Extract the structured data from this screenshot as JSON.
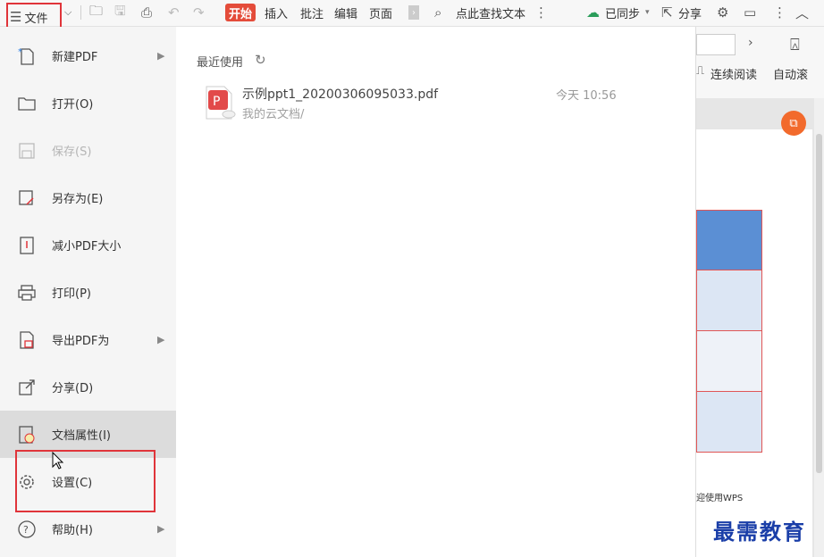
{
  "toolbar": {
    "file_label": "文件",
    "start_label": "开始",
    "tabs": [
      "插入",
      "批注",
      "编辑",
      "页面"
    ],
    "search_label": "点此查找文本",
    "sync_label": "已同步",
    "share_label": "分享"
  },
  "menu": {
    "items": [
      {
        "label": "新建PDF",
        "icon": "new-pdf-icon",
        "has_arrow": true
      },
      {
        "label": "打开(O)",
        "icon": "folder-open-icon",
        "has_arrow": false
      },
      {
        "label": "保存(S)",
        "icon": "save-icon",
        "has_arrow": false,
        "disabled": true
      },
      {
        "label": "另存为(E)",
        "icon": "save-as-icon",
        "has_arrow": false
      },
      {
        "label": "减小PDF大小",
        "icon": "compress-icon",
        "has_arrow": false
      },
      {
        "label": "打印(P)",
        "icon": "print-icon",
        "has_arrow": false
      },
      {
        "label": "导出PDF为",
        "icon": "export-icon",
        "has_arrow": true
      },
      {
        "label": "分享(D)",
        "icon": "share-icon",
        "has_arrow": false
      },
      {
        "label": "文档属性(I)",
        "icon": "properties-icon",
        "has_arrow": false,
        "hover": true
      },
      {
        "label": "设置(C)",
        "icon": "gear-icon",
        "has_arrow": false
      },
      {
        "label": "帮助(H)",
        "icon": "help-icon",
        "has_arrow": true
      }
    ]
  },
  "recent": {
    "title": "最近使用",
    "files": [
      {
        "name": "示例ppt1_20200306095033.pdf",
        "location": "我的云文档/",
        "time": "今天 10:56"
      }
    ]
  },
  "right_panel": {
    "continuous_label": "连续阅读",
    "auto_label": "自动滚",
    "page_footer": "迎使用WPS"
  },
  "watermark": "最需教育",
  "colors": {
    "accent_red": "#e0343a",
    "start_tab": "#e44c3a",
    "table_header": "#5b8fd4",
    "table_row": "#dce6f4"
  }
}
